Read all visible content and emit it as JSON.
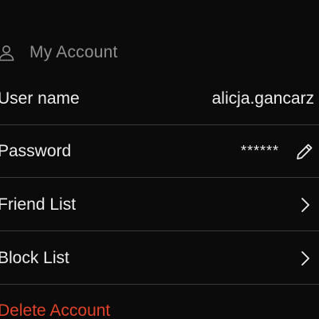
{
  "section": {
    "title": "My Account",
    "icon": "user-icon"
  },
  "rows": {
    "username": {
      "label": "User name",
      "value": "alicja.gancarz"
    },
    "password": {
      "label": "Password",
      "value": "******",
      "icon": "pencil-icon"
    },
    "friend_list": {
      "label": "Friend List",
      "icon": "chevron-right-icon"
    },
    "block_list": {
      "label": "Block List",
      "icon": "chevron-right-icon"
    }
  },
  "delete_account": {
    "label": "Delete Account",
    "color": "#e0432a"
  },
  "colors": {
    "background": "#0b0b0b",
    "text": "#ececec",
    "muted": "#8e8e8e",
    "divider": "#3a3a3a"
  }
}
